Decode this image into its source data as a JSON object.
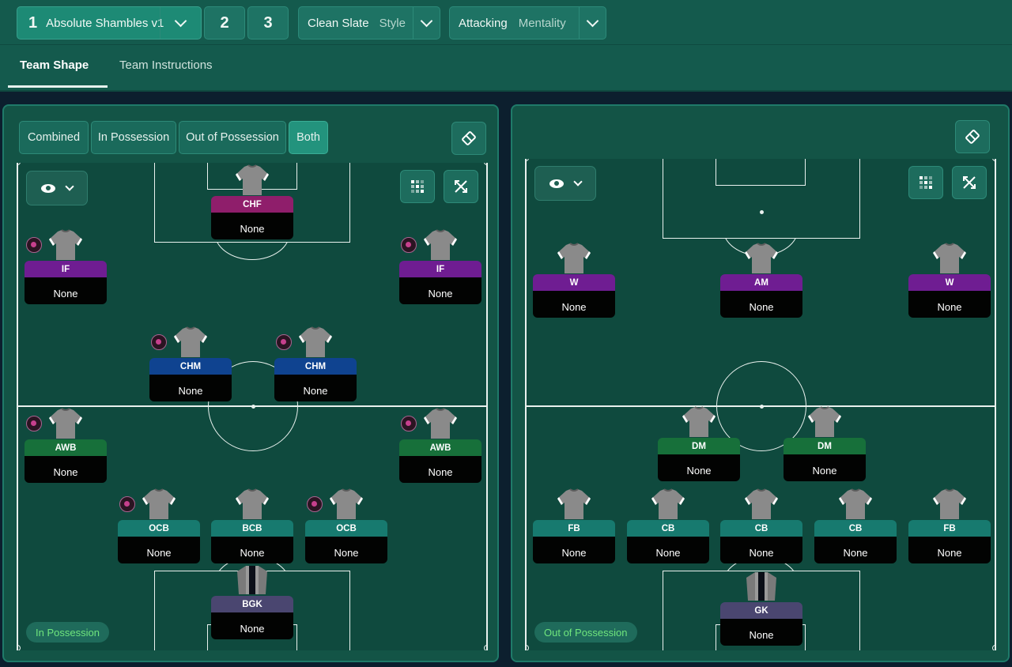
{
  "tactics": {
    "slot1": {
      "number": "1",
      "name": "Absolute Shambles v1"
    },
    "slot2": {
      "number": "2"
    },
    "slot3": {
      "number": "3"
    },
    "style": {
      "value": "Clean Slate",
      "label": "Style"
    },
    "mentality": {
      "value": "Attacking",
      "label": "Mentality"
    }
  },
  "tabs": {
    "team_shape": "Team Shape",
    "team_instructions": "Team Instructions"
  },
  "left_panel": {
    "filters": {
      "combined": "Combined",
      "in_possession": "In Possession",
      "out_of_possession": "Out of Possession",
      "both": "Both"
    },
    "badge": "In Possession",
    "players": [
      {
        "role": "CHF",
        "name": "None",
        "color": "#8f1e6b"
      },
      {
        "role": "IF",
        "name": "None",
        "color": "#6f1d92"
      },
      {
        "role": "IF",
        "name": "None",
        "color": "#6f1d92"
      },
      {
        "role": "CHM",
        "name": "None",
        "color": "#0f4390"
      },
      {
        "role": "CHM",
        "name": "None",
        "color": "#0f4390"
      },
      {
        "role": "AWB",
        "name": "None",
        "color": "#17703a"
      },
      {
        "role": "AWB",
        "name": "None",
        "color": "#17703a"
      },
      {
        "role": "OCB",
        "name": "None",
        "color": "#177a6f"
      },
      {
        "role": "BCB",
        "name": "None",
        "color": "#177a6f"
      },
      {
        "role": "OCB",
        "name": "None",
        "color": "#177a6f"
      },
      {
        "role": "BGK",
        "name": "None",
        "color": "#4a4670"
      }
    ]
  },
  "right_panel": {
    "badge": "Out of Possession",
    "players": [
      {
        "role": "W",
        "name": "None",
        "color": "#6f1d92"
      },
      {
        "role": "AM",
        "name": "None",
        "color": "#6f1d92"
      },
      {
        "role": "W",
        "name": "None",
        "color": "#6f1d92"
      },
      {
        "role": "DM",
        "name": "None",
        "color": "#17703a"
      },
      {
        "role": "DM",
        "name": "None",
        "color": "#17703a"
      },
      {
        "role": "FB",
        "name": "None",
        "color": "#177a6f"
      },
      {
        "role": "CB",
        "name": "None",
        "color": "#177a6f"
      },
      {
        "role": "CB",
        "name": "None",
        "color": "#177a6f"
      },
      {
        "role": "CB",
        "name": "None",
        "color": "#177a6f"
      },
      {
        "role": "FB",
        "name": "None",
        "color": "#177a6f"
      },
      {
        "role": "GK",
        "name": "None",
        "color": "#4a4670"
      }
    ]
  },
  "colors": {
    "accent": "#1d8a75",
    "in_possession_text": "#6fe57d"
  }
}
